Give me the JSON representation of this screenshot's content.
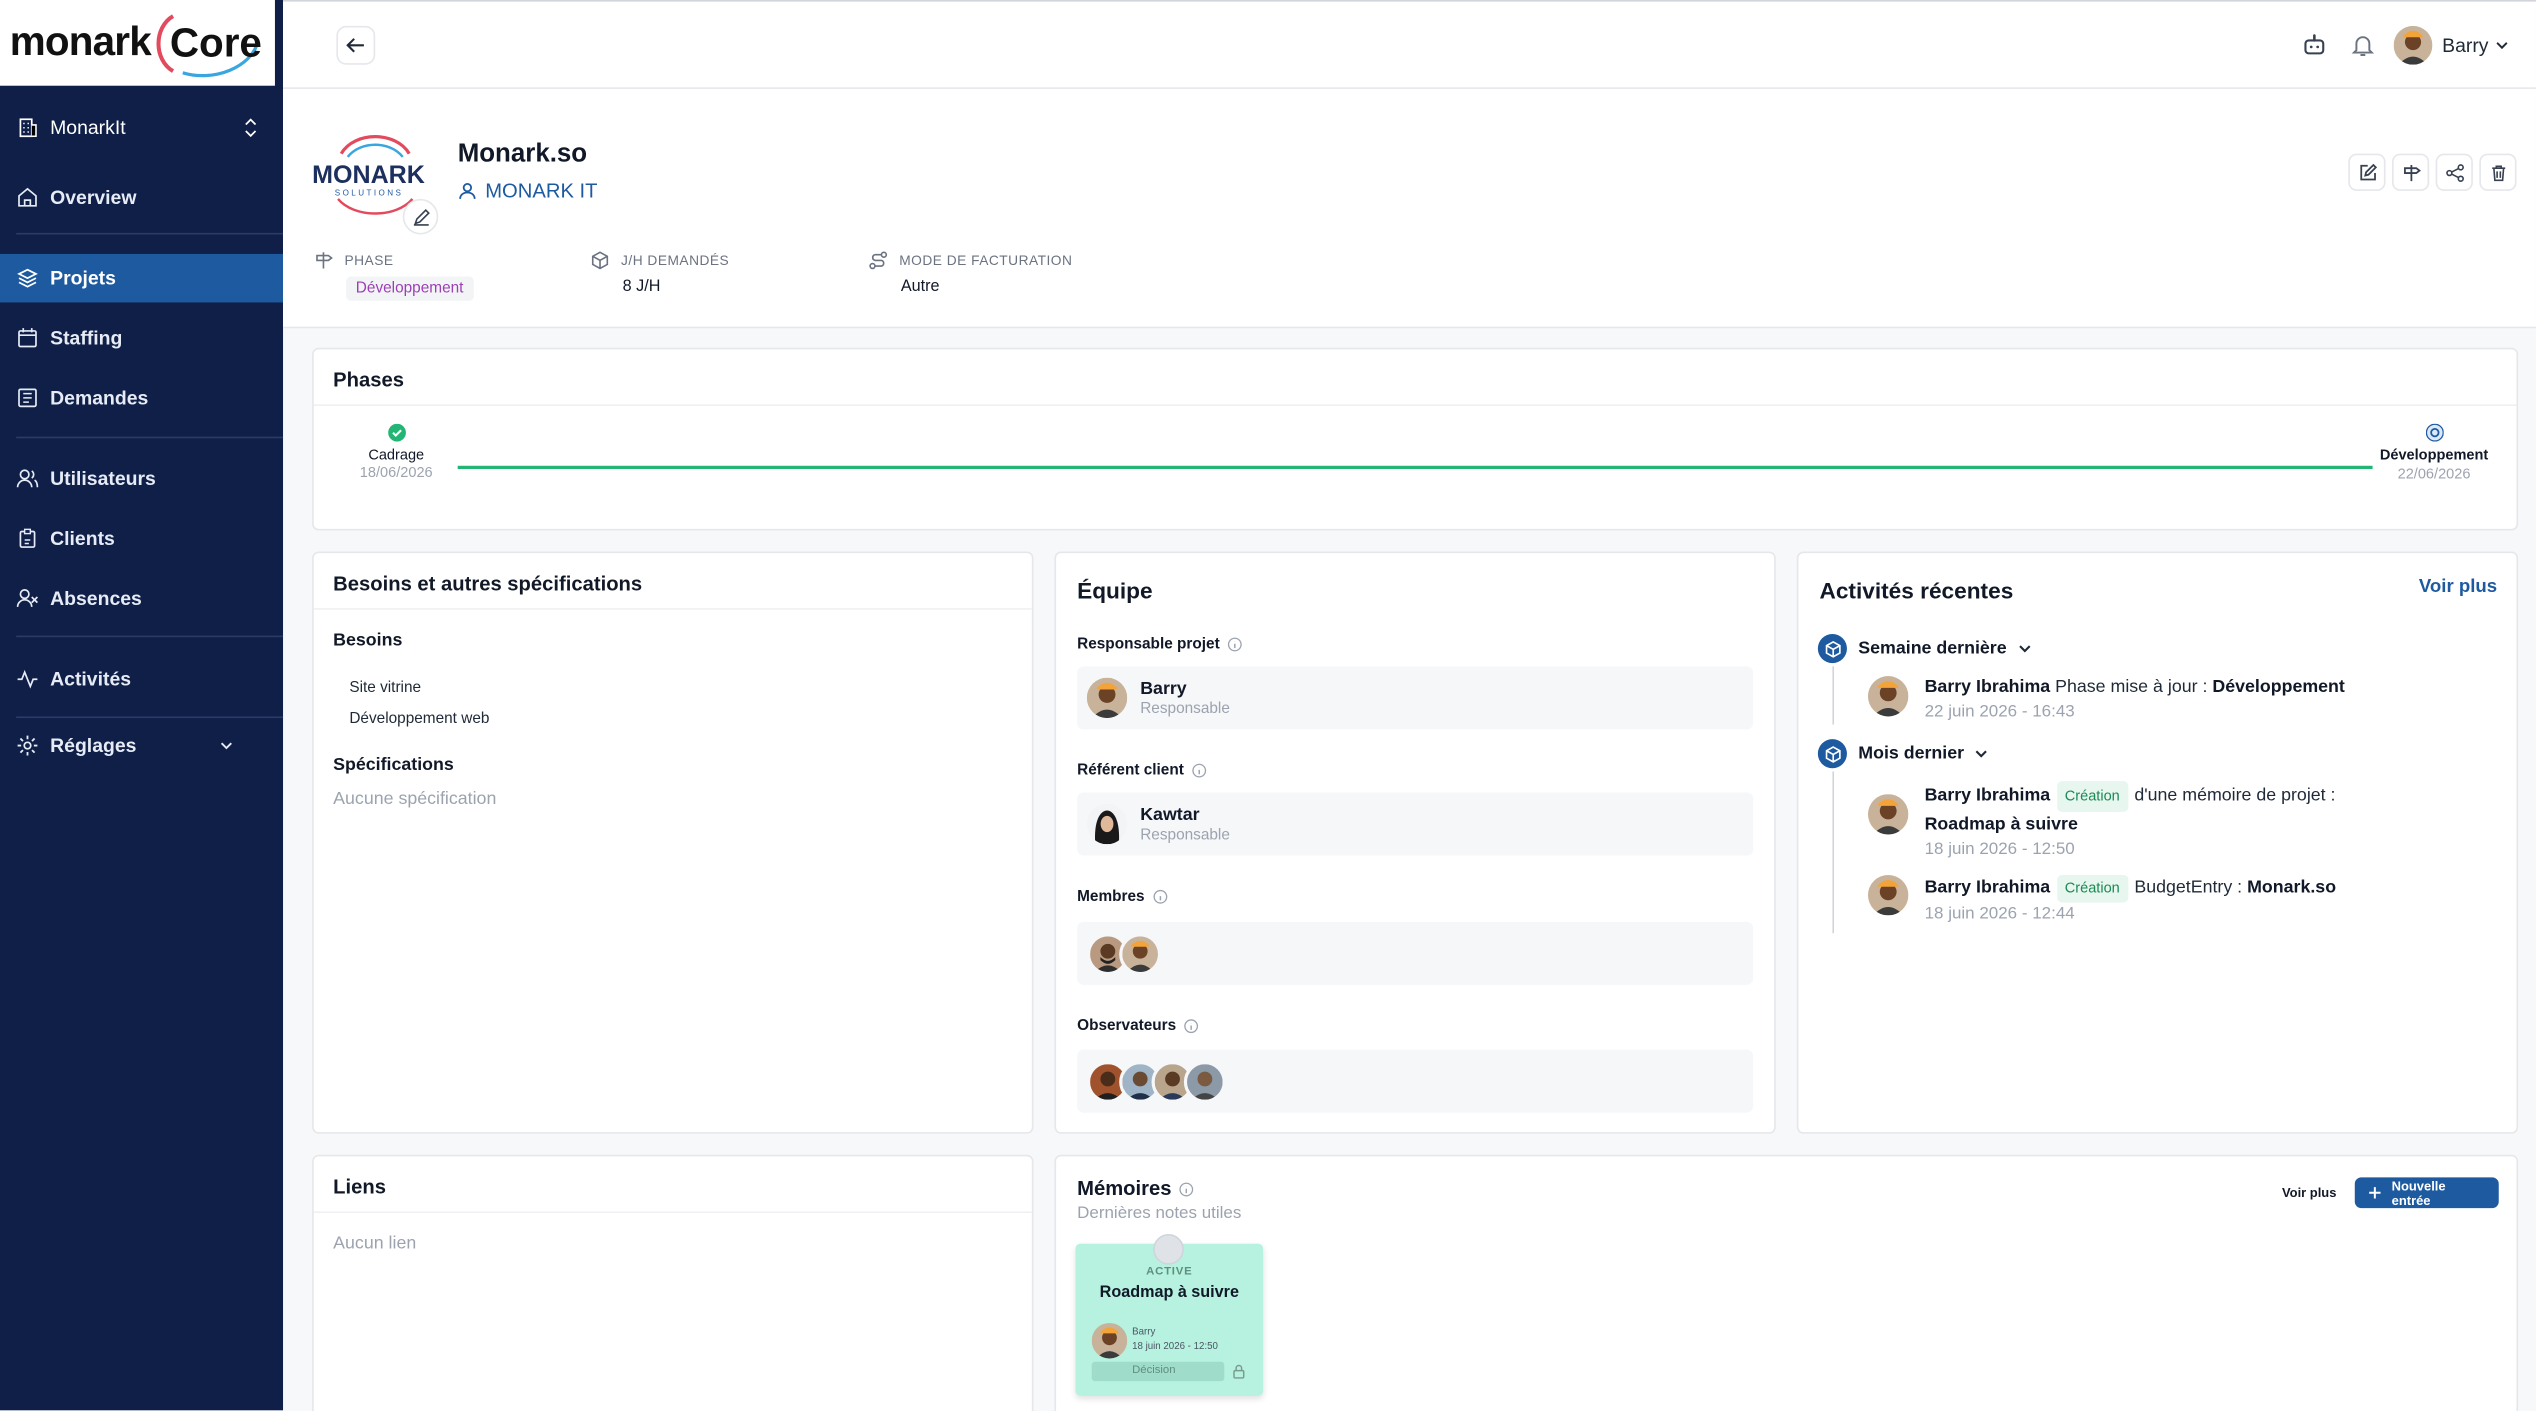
{
  "brand": {
    "logo_left": "monark",
    "logo_right": "Core"
  },
  "sidebar": {
    "workspace": "MonarkIt",
    "items": [
      {
        "label": "Overview"
      },
      {
        "label": "Projets"
      },
      {
        "label": "Staffing"
      },
      {
        "label": "Demandes"
      },
      {
        "label": "Utilisateurs"
      },
      {
        "label": "Clients"
      },
      {
        "label": "Absences"
      },
      {
        "label": "Activités"
      },
      {
        "label": "Réglages"
      }
    ],
    "active_label": "Projets"
  },
  "topbar": {
    "user_name": "Barry"
  },
  "project": {
    "logo_text": "MONARK",
    "logo_sub": "SOLUTIONS",
    "name": "Monark.so",
    "client": "MONARK IT",
    "meta": [
      {
        "label": "PHASE",
        "value": "Développement"
      },
      {
        "label": "J/H DEMANDÉS",
        "value": "8 J/H"
      },
      {
        "label": "MODE DE FACTURATION",
        "value": "Autre"
      }
    ]
  },
  "phases": {
    "title": "Phases",
    "steps": [
      {
        "name": "Cadrage",
        "date": "18/06/2026",
        "status": "done"
      },
      {
        "name": "Développement",
        "date": "22/06/2026",
        "status": "current"
      }
    ]
  },
  "besoins": {
    "title": "Besoins et autres spécifications",
    "besoins_label": "Besoins",
    "items": [
      "Site vitrine",
      "Développement web"
    ],
    "specs_label": "Spécifications",
    "specs_empty": "Aucune spécification"
  },
  "equipe": {
    "title": "Équipe",
    "responsable_label": "Responsable projet",
    "responsable": {
      "name": "Barry",
      "role": "Responsable"
    },
    "referent_label": "Référent client",
    "referent": {
      "name": "Kawtar",
      "role": "Responsable"
    },
    "membres_label": "Membres",
    "observateurs_label": "Observateurs"
  },
  "activites": {
    "title": "Activités récentes",
    "more": "Voir plus",
    "groups": [
      {
        "label": "Semaine dernière",
        "entries": [
          {
            "author": "Barry Ibrahima",
            "text": "Phase mise à jour :",
            "target": "Développement",
            "date": "22 juin 2026 - 16:43"
          }
        ]
      },
      {
        "label": "Mois dernier",
        "entries": [
          {
            "author": "Barry Ibrahima",
            "tag": "Création",
            "text": "d'une mémoire de projet :",
            "target": "Roadmap à suivre",
            "date": "18 juin 2026 - 12:50"
          },
          {
            "author": "Barry Ibrahima",
            "tag": "Création",
            "text": "BudgetEntry :",
            "target": "Monark.so",
            "date": "18 juin 2026 - 12:44"
          }
        ]
      }
    ]
  },
  "liens": {
    "title": "Liens",
    "empty": "Aucun lien"
  },
  "memoires": {
    "title": "Mémoires",
    "subtitle": "Dernières notes utiles",
    "more": "Voir plus",
    "new_entry": "Nouvelle entrée",
    "note": {
      "status": "ACTIVE",
      "title": "Roadmap à suivre",
      "author": "Barry",
      "date": "18 juin 2026 - 12:50",
      "type": "Décision"
    }
  },
  "colors": {
    "sidebar": "#0f1f48",
    "accent": "#1e5aa0",
    "success": "#22b573",
    "phase_badge": "#9b3fb5"
  },
  "icons": [
    "building-icon",
    "home-icon",
    "layers-icon",
    "calendar-icon",
    "inbox-icon",
    "users-icon",
    "clipboard-icon",
    "user-x-icon",
    "activity-icon",
    "settings-icon",
    "arrow-left-icon",
    "bot-icon",
    "bell-icon",
    "edit-icon",
    "signpost-icon",
    "share-icon",
    "trash-icon",
    "box-icon",
    "route-icon",
    "info-icon",
    "plus-icon",
    "lock-icon"
  ]
}
